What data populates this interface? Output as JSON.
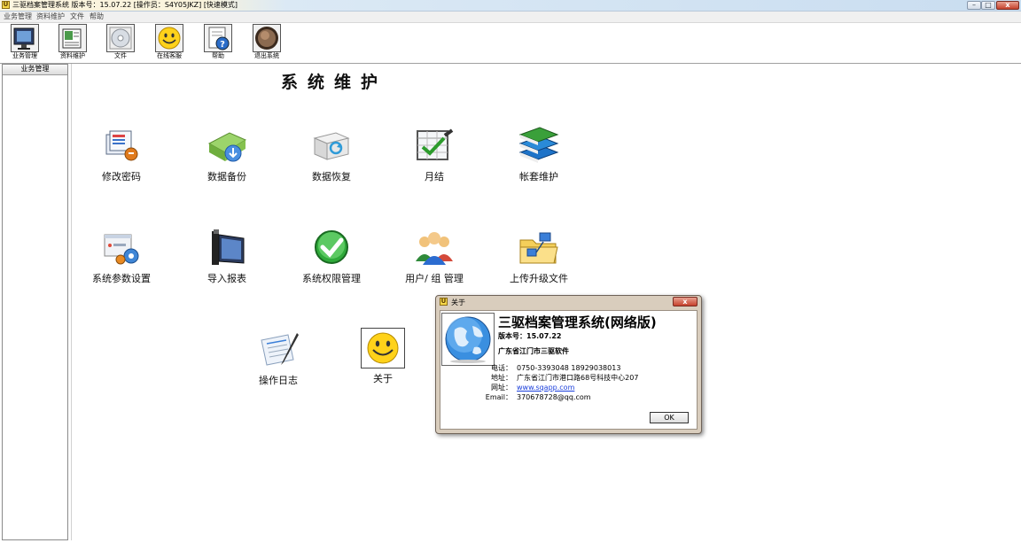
{
  "window": {
    "app_icon_glyph": "U",
    "title": "三驱档案管理系统   版本号：15.07.22   [操作员：S4Y05JKZ]   [快速模式]",
    "min_glyph": "–",
    "max_glyph": "□",
    "close_glyph": "x"
  },
  "menu": {
    "items": [
      "业务管理",
      "资料维护",
      "文件",
      "帮助"
    ]
  },
  "toolbar": {
    "items": [
      {
        "label": "业务管理",
        "icon": "monitor-icon"
      },
      {
        "label": "资料维护",
        "icon": "book-edit-icon"
      },
      {
        "label": "文件",
        "icon": "disc-icon"
      },
      {
        "label": "在线客服",
        "icon": "smiley-icon"
      },
      {
        "label": "帮助",
        "icon": "help-document-icon"
      },
      {
        "label": "退出系统",
        "icon": "exit-circle-icon"
      }
    ]
  },
  "sidebar": {
    "header": "业务管理"
  },
  "main": {
    "title": "系统维护",
    "features": [
      {
        "label": "修改密码",
        "icon": "change-password-icon"
      },
      {
        "label": "数据备份",
        "icon": "data-backup-icon"
      },
      {
        "label": "数据恢复",
        "icon": "data-restore-icon"
      },
      {
        "label": "月结",
        "icon": "month-end-icon"
      },
      {
        "label": "帐套维护",
        "icon": "account-books-icon"
      },
      {
        "label": "系统参数设置",
        "icon": "system-settings-icon"
      },
      {
        "label": "导入报表",
        "icon": "import-report-icon"
      },
      {
        "label": "系统权限管理",
        "icon": "permission-check-icon"
      },
      {
        "label": "用户/ 组 管理",
        "icon": "user-group-icon"
      },
      {
        "label": "上传升级文件",
        "icon": "upload-upgrade-icon"
      },
      {
        "label": "操作日志",
        "icon": "operation-log-icon"
      },
      {
        "label": "关于",
        "icon": "about-smiley-icon"
      }
    ]
  },
  "dialog": {
    "icon_glyph": "U",
    "title": "关于",
    "close_glyph": "x",
    "product_name": "三驱档案管理系统(网络版)",
    "version": "版本号：15.07.22",
    "company": "广东省江门市三驱软件",
    "info": [
      {
        "label": "电话：",
        "value": "0750-3393048  18929038013",
        "link": false
      },
      {
        "label": "地址：",
        "value": "广东省江门市港口路68号科技中心207",
        "link": false
      },
      {
        "label": "网址：",
        "value": "www.sqapp.com",
        "link": true
      },
      {
        "label": "Email：",
        "value": "370678728@qq.com",
        "link": false
      }
    ],
    "ok_label": "OK"
  },
  "colors": {
    "dialog_frame": "#d9cdbd",
    "link": "#1a3edb",
    "close_button": "#c6412c"
  }
}
